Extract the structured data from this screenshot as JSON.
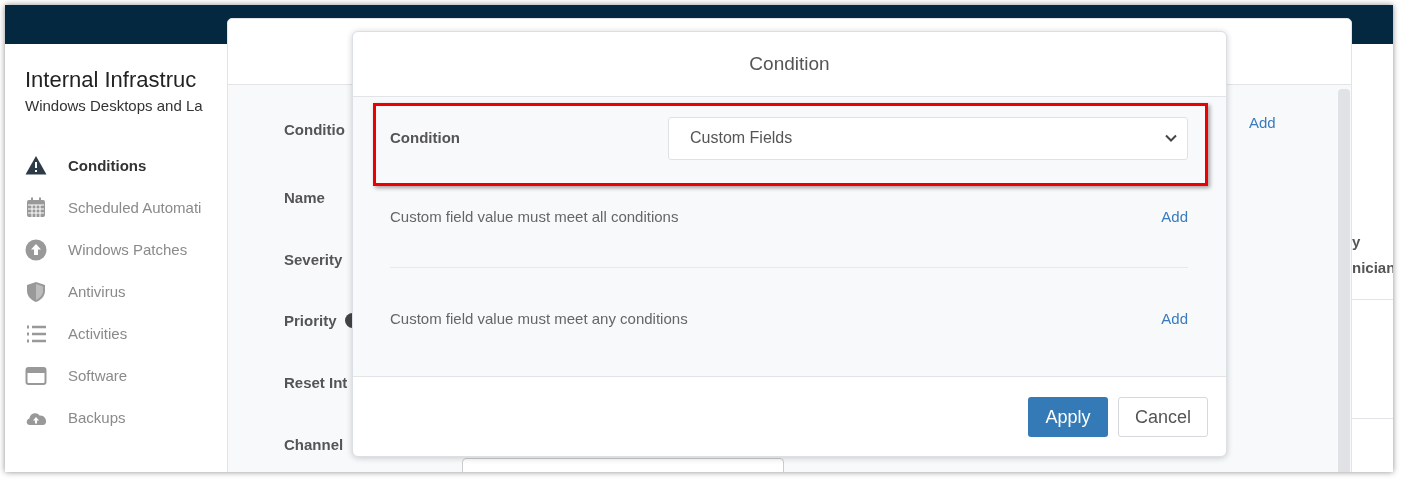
{
  "page": {
    "title": "Internal Infrastruc",
    "subtitle": "Windows Desktops and La",
    "nav": [
      {
        "label": "Conditions",
        "selected": true
      },
      {
        "label": "Scheduled Automati",
        "selected": false
      },
      {
        "label": "Windows Patches",
        "selected": false
      },
      {
        "label": "Antivirus",
        "selected": false
      },
      {
        "label": "Activities",
        "selected": false
      },
      {
        "label": "Software",
        "selected": false
      },
      {
        "label": "Backups",
        "selected": false
      }
    ],
    "column_header": [
      "y",
      "nician"
    ]
  },
  "policy_modal": {
    "labels": [
      "Conditio",
      "Name",
      "Severity",
      "Priority",
      "Reset Int",
      "Channel"
    ],
    "add_link": "Add"
  },
  "condition_dialog": {
    "title": "Condition",
    "field_label": "Condition",
    "select_value": "Custom Fields",
    "groups": [
      {
        "text": "Custom field value must meet all conditions",
        "action": "Add"
      },
      {
        "text": "Custom field value must meet any conditions",
        "action": "Add"
      }
    ],
    "buttons": [
      {
        "label": "Apply",
        "kind": "primary"
      },
      {
        "label": "Cancel",
        "kind": "secondary"
      }
    ]
  }
}
